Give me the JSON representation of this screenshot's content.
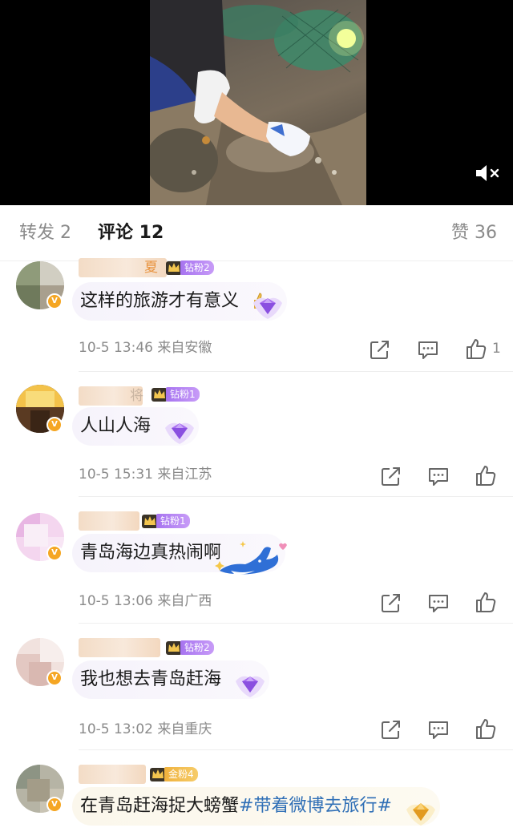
{
  "tabs": {
    "repost": "转发 2",
    "comments": "评论 12",
    "likes": "赞 36"
  },
  "colors": {
    "accent_orange": "#e89440",
    "hashtag_blue": "#2f6fb6",
    "diamond_badge": "#b07cf2",
    "gold_badge": "#f0b23d",
    "meta_gray": "#8a8a8a"
  },
  "comments": [
    {
      "name_suffix": "夏",
      "fan_level": "钻粉2",
      "text": "这样的旅游才有意义",
      "time_location": "10-5 13:46 来自安徽",
      "like_count": "1",
      "bubble_icon": "diamond-heart-icon"
    },
    {
      "name_suffix": "将",
      "fan_level": "钻粉1",
      "text": "人山人海",
      "time_location": "10-5 15:31 来自江苏",
      "like_count": "",
      "bubble_icon": "diamond-heart-icon"
    },
    {
      "name_suffix": "",
      "fan_level": "钻粉1",
      "text": "青岛海边真热闹啊",
      "time_location": "10-5 13:06 来自广西",
      "like_count": "",
      "bubble_icon": "whale-icon"
    },
    {
      "name_suffix": "",
      "fan_level": "钻粉2",
      "text": "我也想去青岛赶海",
      "time_location": "10-5 13:02 来自重庆",
      "like_count": "",
      "bubble_icon": "diamond-heart-icon"
    },
    {
      "name_suffix": "",
      "fan_level": "金粉4",
      "text": "在青岛赶海捉大螃蟹",
      "hashtag": "#带着微博去旅行#",
      "time_location": "",
      "like_count": "",
      "bubble_icon": "gold-gem-icon"
    }
  ],
  "icons": {
    "mute": "speaker-muted-icon",
    "share": "share-icon",
    "reply": "comment-icon",
    "like": "thumbs-up-icon",
    "verified": "verified-v-icon",
    "crown": "crown-icon"
  }
}
